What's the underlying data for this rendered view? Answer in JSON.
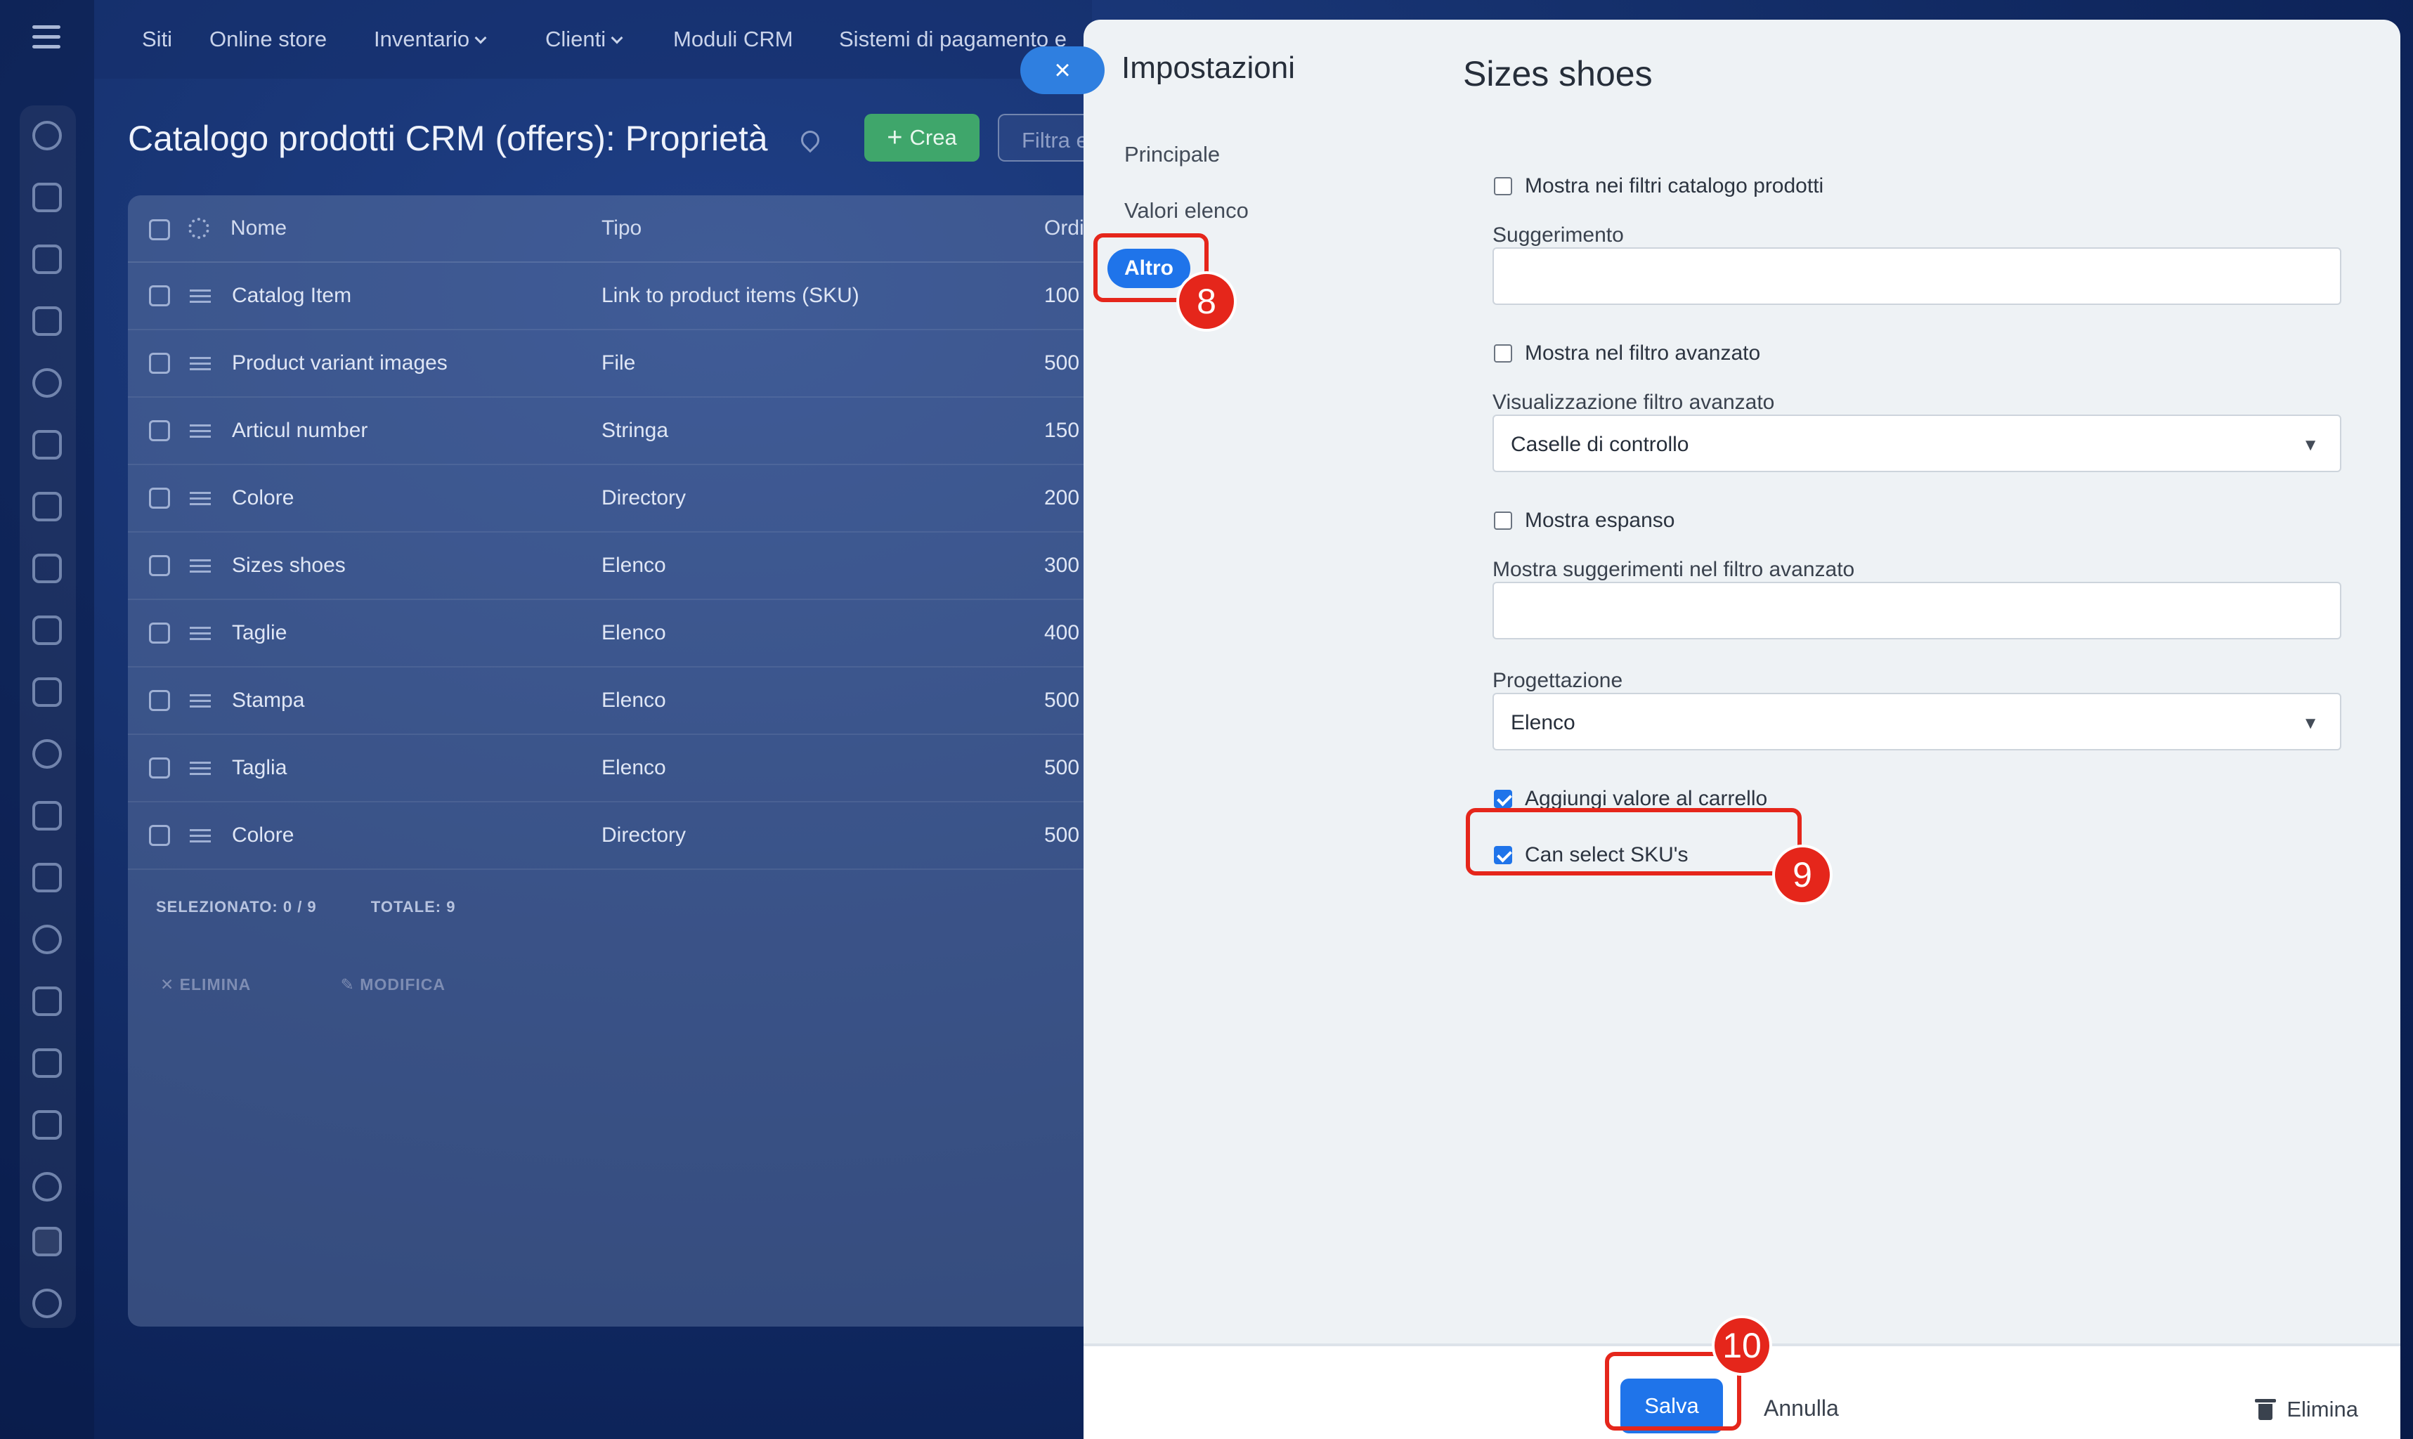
{
  "topnav": {
    "items": [
      "Siti",
      "Online store",
      "Inventario",
      "Clienti",
      "Moduli CRM",
      "Sistemi di pagamento e"
    ]
  },
  "page": {
    "title": "Catalogo prodotti CRM (offers): Proprietà",
    "create_label": "Crea",
    "filter_placeholder": "Filtra e"
  },
  "table": {
    "headers": [
      "Nome",
      "Tipo",
      "Ordi"
    ],
    "rows": [
      {
        "name": "Catalog Item",
        "type": "Link to product items (SKU)",
        "order": "100"
      },
      {
        "name": "Product variant images",
        "type": "File",
        "order": "500"
      },
      {
        "name": "Articul number",
        "type": "Stringa",
        "order": "150"
      },
      {
        "name": "Colore",
        "type": "Directory",
        "order": "200"
      },
      {
        "name": "Sizes shoes",
        "type": "Elenco",
        "order": "300"
      },
      {
        "name": "Taglie",
        "type": "Elenco",
        "order": "400"
      },
      {
        "name": "Stampa",
        "type": "Elenco",
        "order": "500"
      },
      {
        "name": "Taglia",
        "type": "Elenco",
        "order": "500"
      },
      {
        "name": "Colore",
        "type": "Directory",
        "order": "500"
      }
    ],
    "selected": "SELEZIONATO: 0 / 9",
    "total": "TOTALE: 9",
    "delete_action": "ELIMINA",
    "edit_action": "MODIFICA"
  },
  "panel": {
    "close_label": "×",
    "settings_title": "Impostazioni",
    "menu": {
      "principale": "Principale",
      "valori_elenco": "Valori elenco",
      "altro": "Altro"
    },
    "form_title": "Sizes shoes",
    "fields": {
      "show_in_filters": {
        "label": "Mostra nei filtri catalogo prodotti",
        "checked": false
      },
      "hint_label": "Suggerimento",
      "hint_value": "",
      "show_adv_filter": {
        "label": "Mostra nel filtro avanzato",
        "checked": false
      },
      "adv_filter_view_label": "Visualizzazione filtro avanzato",
      "adv_filter_view_value": "Caselle di controllo",
      "show_expanded": {
        "label": "Mostra espanso",
        "checked": false
      },
      "adv_hints_label": "Mostra suggerimenti nel filtro avanzato",
      "adv_hints_value": "",
      "design_label": "Progettazione",
      "design_value": "Elenco",
      "add_to_cart": {
        "label": "Aggiungi valore al carrello",
        "checked": true
      },
      "can_select_sku": {
        "label": "Can select SKU's",
        "checked": true
      }
    },
    "footer": {
      "save": "Salva",
      "cancel": "Annulla",
      "delete": "Elimina"
    }
  },
  "callouts": {
    "step8": "8",
    "step9": "9",
    "step10": "10"
  },
  "colors": {
    "accent": "#1f74ea",
    "callout": "#e5261b",
    "create": "#3fa66b"
  }
}
